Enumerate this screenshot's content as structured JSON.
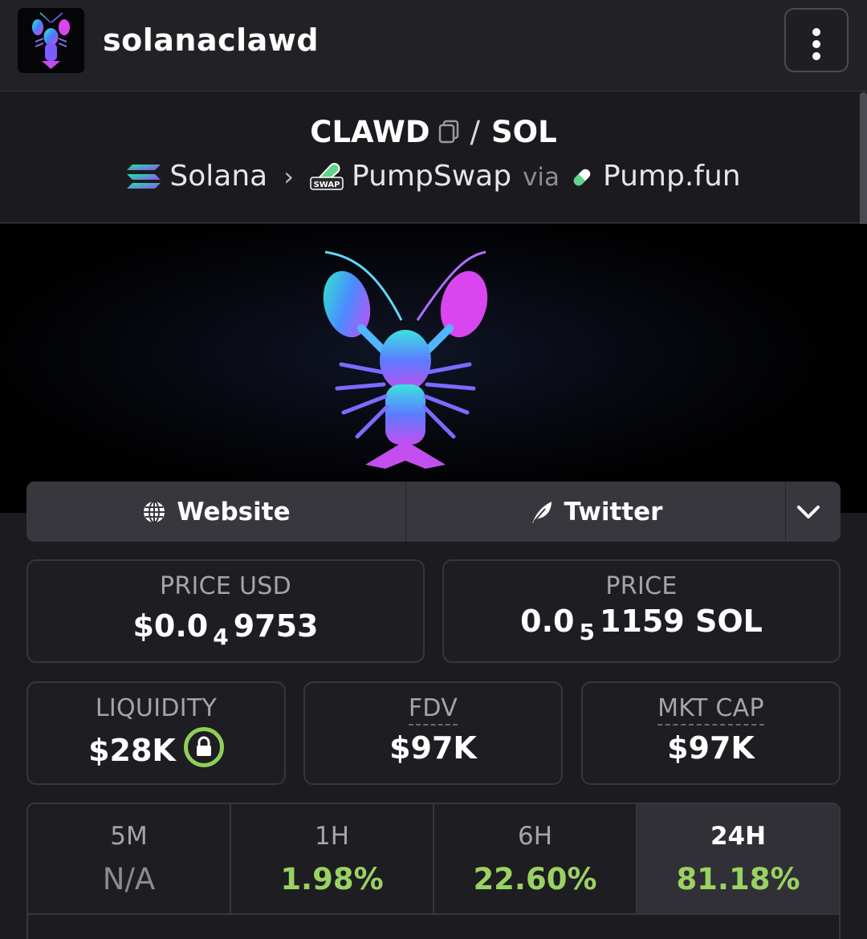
{
  "header": {
    "app_name": "solanaclawd",
    "menu_icon": "kebab-menu-icon"
  },
  "pair": {
    "base": "CLAWD",
    "separator": "/",
    "quote": "SOL",
    "chain": "Solana",
    "dex": "PumpSwap",
    "dex_badge": "SWAP",
    "via": "via",
    "launchpad": "Pump.fun"
  },
  "links": {
    "website": "Website",
    "twitter": "Twitter"
  },
  "price_usd": {
    "label": "PRICE USD",
    "prefix": "$0.0",
    "zeros": "4",
    "digits": "9753"
  },
  "price_native": {
    "label": "PRICE",
    "prefix": "0.0",
    "zeros": "5",
    "digits": "1159 SOL"
  },
  "liquidity": {
    "label": "LIQUIDITY",
    "value": "$28K"
  },
  "fdv": {
    "label": "FDV",
    "value": "$97K"
  },
  "mkt_cap": {
    "label": "MKT CAP",
    "value": "$97K"
  },
  "changes": [
    {
      "label": "5M",
      "value": "N/A"
    },
    {
      "label": "1H",
      "value": "1.98%"
    },
    {
      "label": "6H",
      "value": "22.60%"
    },
    {
      "label": "24H",
      "value": "81.18%"
    }
  ],
  "colors": {
    "positive": "#9bd162",
    "lock_ring": "#8fcf56",
    "background": "#1b1b20"
  }
}
